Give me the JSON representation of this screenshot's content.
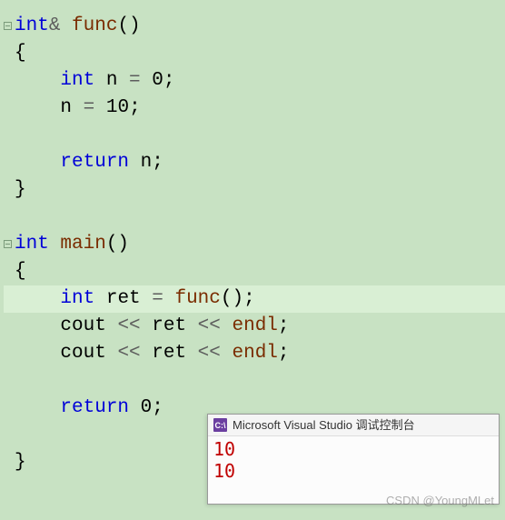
{
  "code": {
    "l1_kw1": "int",
    "l1_amp": "&",
    "l1_fn": "func",
    "l1_paren": "()",
    "l2_brace": "{",
    "l3_kw": "int",
    "l3_var": " n ",
    "l3_eq": "=",
    "l3_val": " 0",
    "l3_semi": ";",
    "l4_lhs": "n ",
    "l4_eq": "=",
    "l4_val": " 10",
    "l4_semi": ";",
    "l6_kw": "return",
    "l6_val": " n",
    "l6_semi": ";",
    "l7_brace": "}",
    "l9_kw": "int",
    "l9_fn": " main",
    "l9_paren": "()",
    "l10_brace": "{",
    "l11_kw": "int",
    "l11_var": " ret ",
    "l11_eq": "=",
    "l11_sp": " ",
    "l11_fn": "func",
    "l11_paren": "()",
    "l11_semi": ";",
    "l12_obj": "cout ",
    "l12_op1": "<<",
    "l12_var": " ret ",
    "l12_op2": "<<",
    "l12_sp": " ",
    "l12_endl": "endl",
    "l12_semi": ";",
    "l13_obj": "cout ",
    "l13_op1": "<<",
    "l13_var": " ret ",
    "l13_op2": "<<",
    "l13_sp": " ",
    "l13_endl": "endl",
    "l13_semi": ";",
    "l15_kw": "return",
    "l15_val": " 0",
    "l15_semi": ";",
    "l16_brace": "}"
  },
  "console": {
    "icon_text": "C:\\",
    "title": "Microsoft Visual Studio 调试控制台",
    "out1": "10",
    "out2": "10"
  },
  "watermark": "CSDN @YoungMLet"
}
